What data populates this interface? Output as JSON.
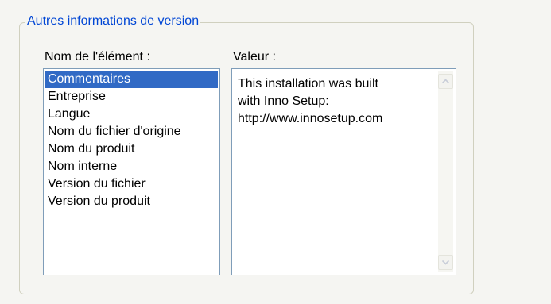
{
  "group": {
    "legend": "Autres informations de version"
  },
  "labels": {
    "item_name": "Nom de l'élément :",
    "value": "Valeur :"
  },
  "items": [
    {
      "label": "Commentaires",
      "selected": true
    },
    {
      "label": "Entreprise",
      "selected": false
    },
    {
      "label": "Langue",
      "selected": false
    },
    {
      "label": "Nom du fichier d'origine",
      "selected": false
    },
    {
      "label": "Nom du produit",
      "selected": false
    },
    {
      "label": "Nom interne",
      "selected": false
    },
    {
      "label": "Version du fichier",
      "selected": false
    },
    {
      "label": "Version du produit",
      "selected": false
    }
  ],
  "value_lines": [
    "This installation was built",
    "with Inno Setup:",
    "http://www.innosetup.com"
  ],
  "colors": {
    "legend": "#0046d5",
    "selection": "#316ac5",
    "border": "#7f9db9"
  },
  "icons": {
    "scroll_up": "arrow-up-icon",
    "scroll_down": "arrow-down-icon"
  }
}
